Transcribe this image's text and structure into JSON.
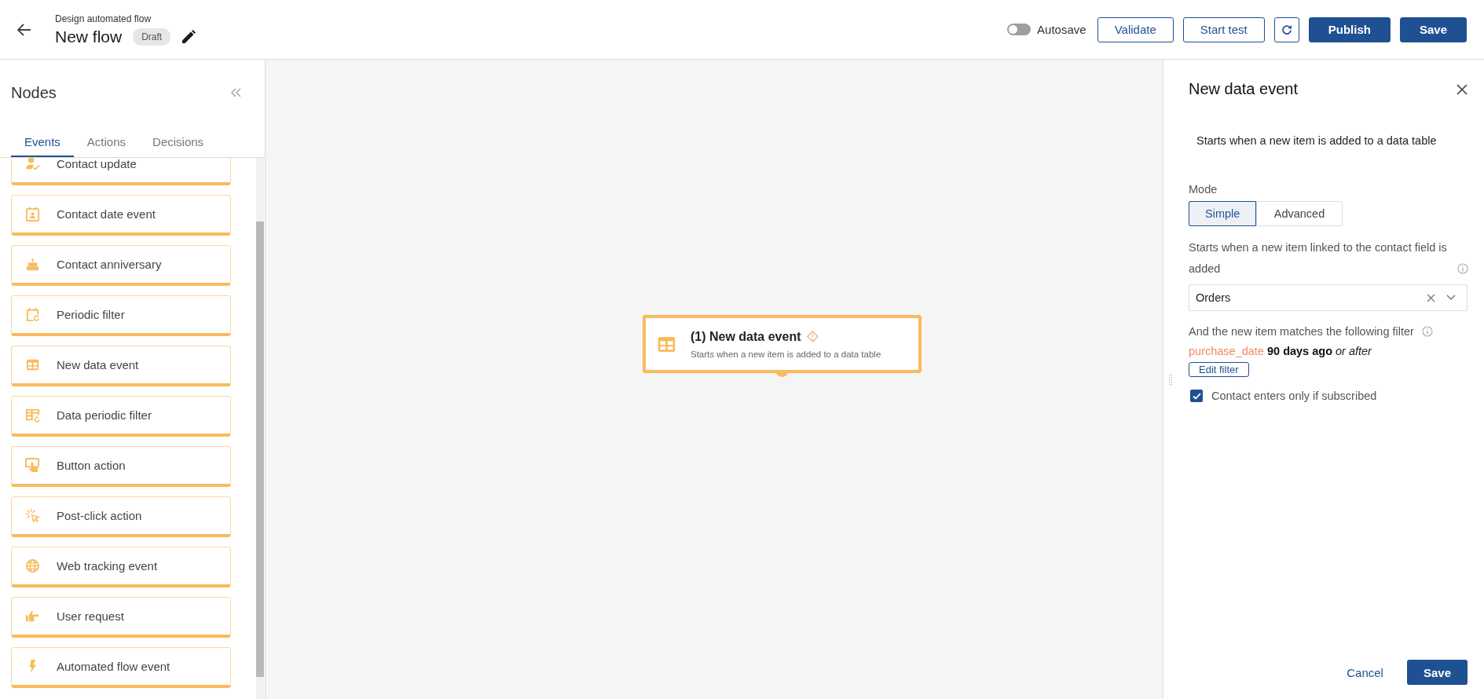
{
  "header": {
    "subtitle": "Design automated flow",
    "title": "New flow",
    "badge": "Draft",
    "autosave": {
      "label": "Autosave",
      "on": false
    },
    "buttons": [
      {
        "kind": "outline",
        "label": "Validate"
      },
      {
        "kind": "outline",
        "label": "Start test"
      },
      {
        "kind": "refresh"
      },
      {
        "kind": "primary",
        "label": "Publish"
      },
      {
        "kind": "primary",
        "label": "Save"
      }
    ]
  },
  "sidebar": {
    "title": "Nodes",
    "tabs": [
      {
        "label": "Events",
        "selected": true
      },
      {
        "label": "Actions",
        "selected": false
      },
      {
        "label": "Decisions",
        "selected": false
      }
    ],
    "items": [
      {
        "kind": "person-check",
        "label": "Contact update"
      },
      {
        "kind": "calendar-person",
        "label": "Contact date event"
      },
      {
        "kind": "cake",
        "label": "Contact anniversary"
      },
      {
        "kind": "calendar-refresh",
        "label": "Periodic filter"
      },
      {
        "kind": "table",
        "label": "New data event"
      },
      {
        "kind": "table-refresh",
        "label": "Data periodic filter"
      },
      {
        "kind": "tap",
        "label": "Button action"
      },
      {
        "kind": "click",
        "label": "Post-click action"
      },
      {
        "kind": "globe",
        "label": "Web tracking event"
      },
      {
        "kind": "hand",
        "label": "User request"
      },
      {
        "kind": "bolt",
        "label": "Automated flow event"
      }
    ]
  },
  "canvas": {
    "node": {
      "title": "(1) New data event",
      "description": "Starts when a new item is added to a data table",
      "warning": true
    }
  },
  "panel": {
    "title": "New data event",
    "description": "Starts when a new item is added to a data table",
    "mode": {
      "label": "Mode",
      "options": [
        {
          "label": "Simple",
          "selected": true
        },
        {
          "label": "Advanced",
          "selected": false
        }
      ]
    },
    "field": {
      "label": "Starts when a new item linked to the contact field is added",
      "value": "Orders"
    },
    "filter": {
      "label": "And the new item matches the following filter",
      "field": "purchase_date",
      "value": "90 days ago",
      "operator": "or after",
      "button": "Edit filter"
    },
    "checkbox": {
      "label": "Contact enters only if subscribed",
      "checked": true
    },
    "buttons": [
      {
        "kind": "link",
        "label": "Cancel"
      },
      {
        "kind": "primary",
        "label": "Save"
      }
    ]
  }
}
